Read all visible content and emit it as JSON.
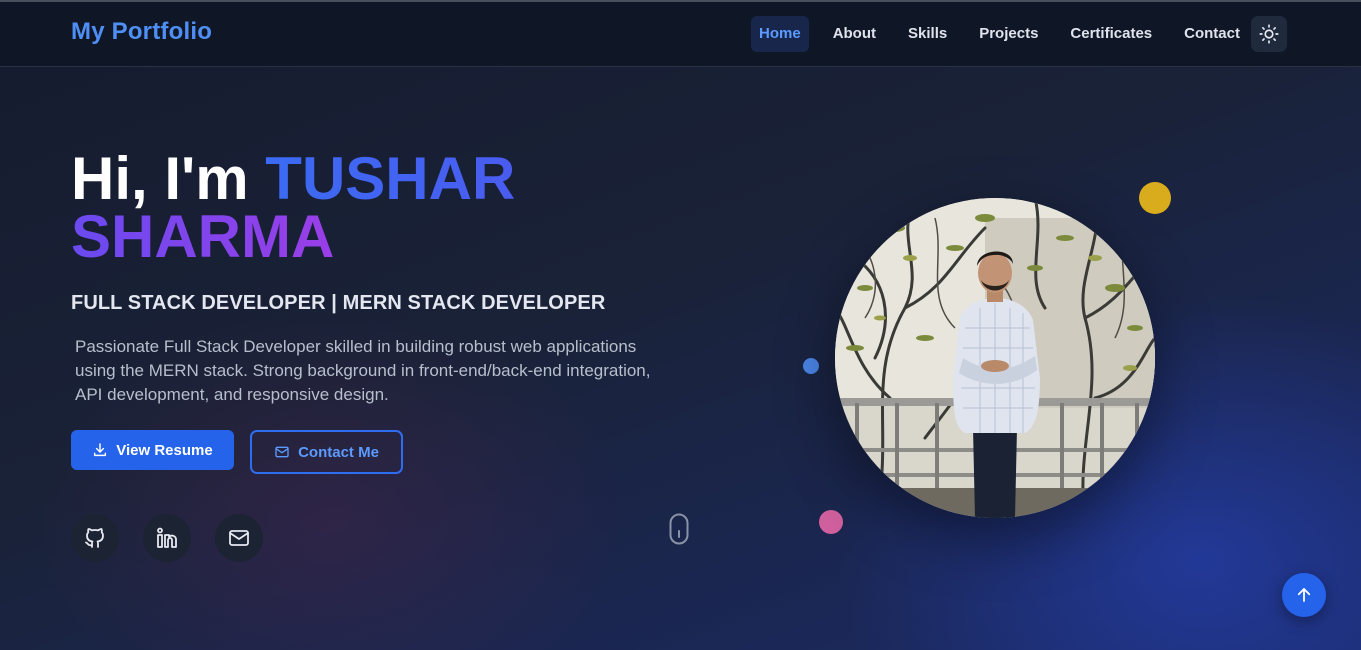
{
  "nav": {
    "logo": "My Portfolio",
    "links": [
      {
        "label": "Home",
        "active": true
      },
      {
        "label": "About"
      },
      {
        "label": "Skills"
      },
      {
        "label": "Projects"
      },
      {
        "label": "Certificates"
      },
      {
        "label": "Contact"
      }
    ],
    "theme_icon": "sun-icon"
  },
  "hero": {
    "greeting": "Hi, I'm ",
    "first_name": "TUSHAR",
    "last_name": "SHARMA",
    "subtitle": "FULL STACK DEVELOPER | MERN STACK DEVELOPER",
    "description": "Passionate Full Stack Developer skilled in building robust web applications using the MERN stack. Strong background in front-end/back-end integration, API development, and responsive design.",
    "primary_button": "View Resume",
    "secondary_button": "Contact Me",
    "socials": [
      "github-icon",
      "linkedin-icon",
      "mail-icon"
    ]
  },
  "colors": {
    "accent": "#2563eb",
    "logo": "#4f8ff5",
    "name_gradient_start": "#3b6bf3",
    "name_gradient_end": "#9a3ee8",
    "dot_yellow": "#d9ac1e",
    "dot_blue": "#4a86e8",
    "dot_pink": "#d0609e"
  }
}
